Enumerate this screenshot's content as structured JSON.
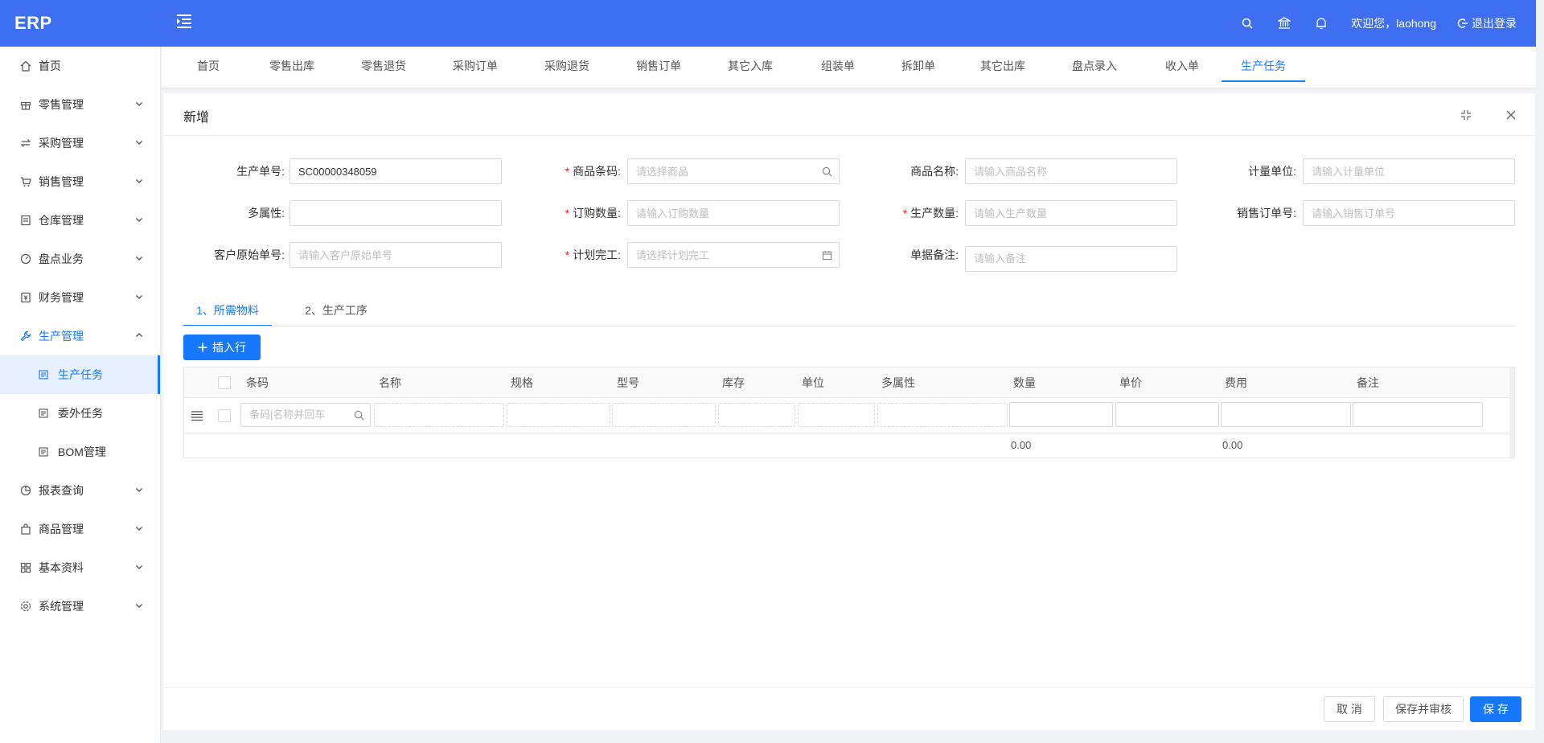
{
  "app": {
    "logo": "ERP"
  },
  "header": {
    "welcome": "欢迎您，laohong",
    "logout": "退出登录"
  },
  "sidebar": {
    "items": [
      {
        "label": "首页"
      },
      {
        "label": "零售管理"
      },
      {
        "label": "采购管理"
      },
      {
        "label": "销售管理"
      },
      {
        "label": "仓库管理"
      },
      {
        "label": "盘点业务"
      },
      {
        "label": "财务管理"
      },
      {
        "label": "生产管理"
      },
      {
        "label": "报表查询"
      },
      {
        "label": "商品管理"
      },
      {
        "label": "基本资料"
      },
      {
        "label": "系统管理"
      }
    ],
    "sub_items": [
      {
        "label": "生产任务"
      },
      {
        "label": "委外任务"
      },
      {
        "label": "BOM管理"
      }
    ]
  },
  "tabs": [
    {
      "label": "首页"
    },
    {
      "label": "零售出库"
    },
    {
      "label": "零售退货"
    },
    {
      "label": "采购订单"
    },
    {
      "label": "采购退货"
    },
    {
      "label": "销售订单"
    },
    {
      "label": "其它入库"
    },
    {
      "label": "组装单"
    },
    {
      "label": "拆卸单"
    },
    {
      "label": "其它出库"
    },
    {
      "label": "盘点录入"
    },
    {
      "label": "收入单"
    },
    {
      "label": "生产任务"
    }
  ],
  "modal": {
    "title": "新增"
  },
  "form": {
    "prod_no": {
      "label": "生产单号:",
      "value": "SC00000348059"
    },
    "barcode": {
      "label": "商品条码:",
      "placeholder": "请选择商品"
    },
    "goods_name": {
      "label": "商品名称:",
      "placeholder": "请输入商品名称"
    },
    "unit": {
      "label": "计量单位:",
      "placeholder": "请输入计量单位"
    },
    "multi_attr": {
      "label": "多属性:",
      "value": ""
    },
    "order_qty": {
      "label": "订购数量:",
      "placeholder": "请输入订购数量"
    },
    "prod_qty": {
      "label": "生产数量:",
      "placeholder": "请输入生产数量"
    },
    "sales_order_no": {
      "label": "销售订单号:",
      "placeholder": "请输入销售订单号"
    },
    "customer_no": {
      "label": "客户原始单号:",
      "placeholder": "请输入客户原始单号"
    },
    "plan_finish": {
      "label": "计划完工:",
      "placeholder": "请选择计划完工"
    },
    "remark": {
      "label": "单据备注:",
      "placeholder": "请输入备注"
    },
    "required_mark": "*"
  },
  "sub_tabs": [
    {
      "label": "1、所需物料"
    },
    {
      "label": "2、生产工序"
    }
  ],
  "insert_row": "插入行",
  "table": {
    "columns": [
      "条码",
      "名称",
      "规格",
      "型号",
      "库存",
      "单位",
      "多属性",
      "数量",
      "单价",
      "费用",
      "备注"
    ],
    "code_placeholder": "条码|名称并回车",
    "totals": {
      "quantity": "0.00",
      "cost": "0.00"
    }
  },
  "footer": {
    "cancel": "取 消",
    "save_audit": "保存并审核",
    "save": "保 存"
  },
  "colors": {
    "primary": "#1677ff",
    "header": "#3d6ff0",
    "required": "#f5222d"
  }
}
